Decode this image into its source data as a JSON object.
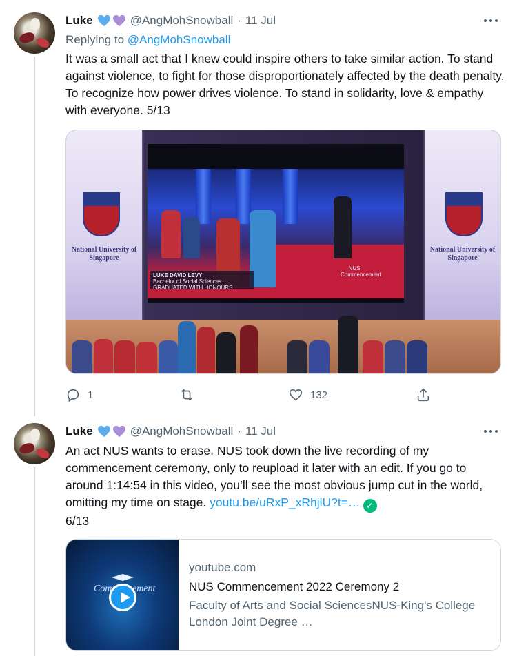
{
  "tweets": [
    {
      "name": "Luke",
      "handle": "@AngMohSnowball",
      "dot": "·",
      "time": "11 Jul",
      "replying_prefix": "Replying to ",
      "replying_handle": "@AngMohSnowball",
      "text": "It was a small act that I knew could inspire others to take similar action. To stand against violence, to fight for those disproportionately affected by the death penalty. To recognize how power drives violence. To stand in solidarity, love & empathy with everyone. 5/13",
      "media": {
        "banner_text": "National University of Singapore",
        "screen_caption_name": "LUKE DAVID LEVY",
        "screen_caption_line2": "Bachelor of Social Sciences",
        "screen_caption_line3": "GRADUATED WITH HONOURS",
        "screen_logo": "NUS Commencement"
      },
      "actions": {
        "replies": "1",
        "retweets": "",
        "likes": "132"
      }
    },
    {
      "name": "Luke",
      "handle": "@AngMohSnowball",
      "dot": "·",
      "time": "11 Jul",
      "text_before_link": "An act NUS wants to erase. NUS took down the live recording of my commencement ceremony, only to reupload it later with an edit. If you go to around 1:14:54 in this video, you’ll see the most obvious jump cut in the world, omitting my time on stage. ",
      "link": "youtu.be/uRxP_xRhjlU?t=…",
      "text_after": "6/13",
      "card": {
        "domain": "youtube.com",
        "title": "NUS Commencement 2022 Ceremony 2",
        "description": "Faculty of Arts and Social SciencesNUS-King's College London Joint Degree …",
        "thumb_script": "Commencement"
      }
    }
  ],
  "colors": {
    "text": "#0f1419",
    "secondary": "#536471",
    "link": "#1d9bf0",
    "verified": "#00ba7c",
    "heart_blue": "#5dadec",
    "heart_purple": "#aa8ed6"
  }
}
